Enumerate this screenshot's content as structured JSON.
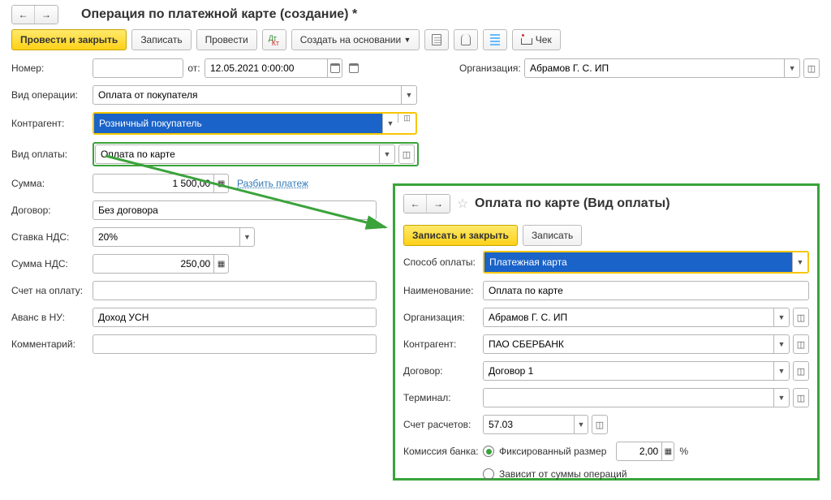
{
  "main": {
    "title": "Операция по платежной карте (создание) *",
    "buttons": {
      "submit_close": "Провести и закрыть",
      "record": "Записать",
      "submit": "Провести",
      "create_based": "Создать на основании",
      "cheque": "Чек"
    },
    "labels": {
      "number": "Номер:",
      "from": "от:",
      "org": "Организация:",
      "op_type": "Вид операции:",
      "counterparty": "Контрагент:",
      "pay_type": "Вид оплаты:",
      "sum": "Сумма:",
      "split": "Разбить платеж",
      "contract": "Договор:",
      "vat_rate": "Ставка НДС:",
      "vat_sum": "Сумма НДС:",
      "invoice": "Счет на оплату:",
      "advance": "Аванс в НУ:",
      "comment": "Комментарий:"
    },
    "values": {
      "number": "",
      "date": "12.05.2021 0:00:00",
      "org": "Абрамов Г. С. ИП",
      "op_type": "Оплата от покупателя",
      "counterparty": "Розничный покупатель",
      "pay_type": "Оплата по карте",
      "sum": "1 500,00",
      "contract": "Без договора",
      "vat_rate": "20%",
      "vat_sum": "250,00",
      "invoice": "",
      "advance": "Доход УСН",
      "comment": ""
    }
  },
  "panel": {
    "title": "Оплата по карте (Вид оплаты)",
    "buttons": {
      "save_close": "Записать и закрыть",
      "save": "Записать"
    },
    "labels": {
      "method": "Способ оплаты:",
      "name": "Наименование:",
      "org": "Организация:",
      "counterparty": "Контрагент:",
      "contract": "Договор:",
      "terminal": "Терминал:",
      "account": "Счет расчетов:",
      "commission": "Комиссия банка:",
      "fixed": "Фиксированный размер",
      "percent": "%",
      "depends": "Зависит от суммы операций"
    },
    "values": {
      "method": "Платежная карта",
      "name": "Оплата по карте",
      "org": "Абрамов Г. С. ИП",
      "counterparty": "ПАО СБЕРБАНК",
      "contract": "Договор 1",
      "terminal": "",
      "account": "57.03",
      "commission_value": "2,00"
    }
  }
}
